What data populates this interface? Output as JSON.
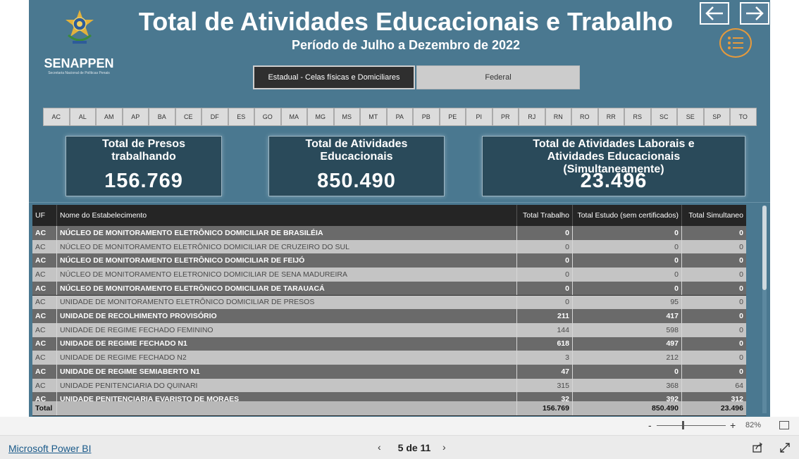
{
  "header": {
    "brand": "SENAPPEN",
    "brand_sub": "Secretaria Nacional de Políticas Penais",
    "title": "Total de Atividades Educacionais e Trabalho",
    "subtitle": "Período de Julho a Dezembro de 2022"
  },
  "nav": {
    "prev_icon": "arrow-left-icon",
    "next_icon": "arrow-right-icon",
    "menu_icon": "list-menu-icon"
  },
  "segments": {
    "estadual": "Estadual - Celas físicas e Domiciliares",
    "federal": "Federal",
    "selected": "estadual"
  },
  "states": [
    "AC",
    "AL",
    "AM",
    "AP",
    "BA",
    "CE",
    "DF",
    "ES",
    "GO",
    "MA",
    "MG",
    "MS",
    "MT",
    "PA",
    "PB",
    "PE",
    "PI",
    "PR",
    "RJ",
    "RN",
    "RO",
    "RR",
    "RS",
    "SC",
    "SE",
    "SP",
    "TO"
  ],
  "kpis": {
    "presos": {
      "title": "Total de Presos trabalhando",
      "value": "156.769"
    },
    "educ": {
      "title": "Total de Atividades Educacionais",
      "value": "850.490"
    },
    "simul": {
      "title": "Total de Atividades Laborais e Atividades Educacionais (Simultaneamente)",
      "value": "23.496"
    }
  },
  "table": {
    "columns": [
      "UF",
      "Nome do Estabelecimento",
      "Total Trabalho",
      "Total Estudo (sem certificados)",
      "Total Simultaneo"
    ],
    "rows": [
      [
        "AC",
        "NÚCLEO DE MONITORAMENTO ELETRÔNICO DOMICILIAR DE BRASILÉIA",
        "0",
        "0",
        "0"
      ],
      [
        "AC",
        "NÚCLEO DE MONITORAMENTO ELETRÔNICO DOMICILIAR DE CRUZEIRO DO SUL",
        "0",
        "0",
        "0"
      ],
      [
        "AC",
        "NÚCLEO DE MONITORAMENTO ELETRÔNICO DOMICILIAR DE FEIJÓ",
        "0",
        "0",
        "0"
      ],
      [
        "AC",
        "NÚCLEO DE MONITORAMENTO ELETRONICO DOMICILIAR DE SENA MADUREIRA",
        "0",
        "0",
        "0"
      ],
      [
        "AC",
        "NÚCLEO DE MONITORAMENTO ELETRÔNICO DOMICILIAR DE TARAUACÁ",
        "0",
        "0",
        "0"
      ],
      [
        "AC",
        "UNIDADE DE MONITORAMENTO ELETRÔNICO DOMICILIAR DE PRESOS",
        "0",
        "95",
        "0"
      ],
      [
        "AC",
        "UNIDADE DE RECOLHIMENTO PROVISÓRIO",
        "211",
        "417",
        "0"
      ],
      [
        "AC",
        "UNIDADE DE REGIME FECHADO FEMININO",
        "144",
        "598",
        "0"
      ],
      [
        "AC",
        "UNIDADE DE REGIME FECHADO N1",
        "618",
        "497",
        "0"
      ],
      [
        "AC",
        "UNIDADE DE REGIME FECHADO N2",
        "3",
        "212",
        "0"
      ],
      [
        "AC",
        "UNIDADE DE REGIME SEMIABERTO N1",
        "47",
        "0",
        "0"
      ],
      [
        "AC",
        "UNIDADE PENITENCIARIA DO QUINARI",
        "315",
        "368",
        "64"
      ],
      [
        "AC",
        "UNIDADE PENITENCIARIA EVARISTO DE MORAES",
        "32",
        "392",
        "312"
      ]
    ],
    "total": [
      "Total",
      "",
      "156.769",
      "850.490",
      "23.496"
    ]
  },
  "zoom": {
    "minus": "-",
    "plus": "+",
    "percent": "82%",
    "level": 0.82
  },
  "footer": {
    "link": "Microsoft Power BI",
    "prev": "‹",
    "page": "5 de 11",
    "next": "›"
  }
}
